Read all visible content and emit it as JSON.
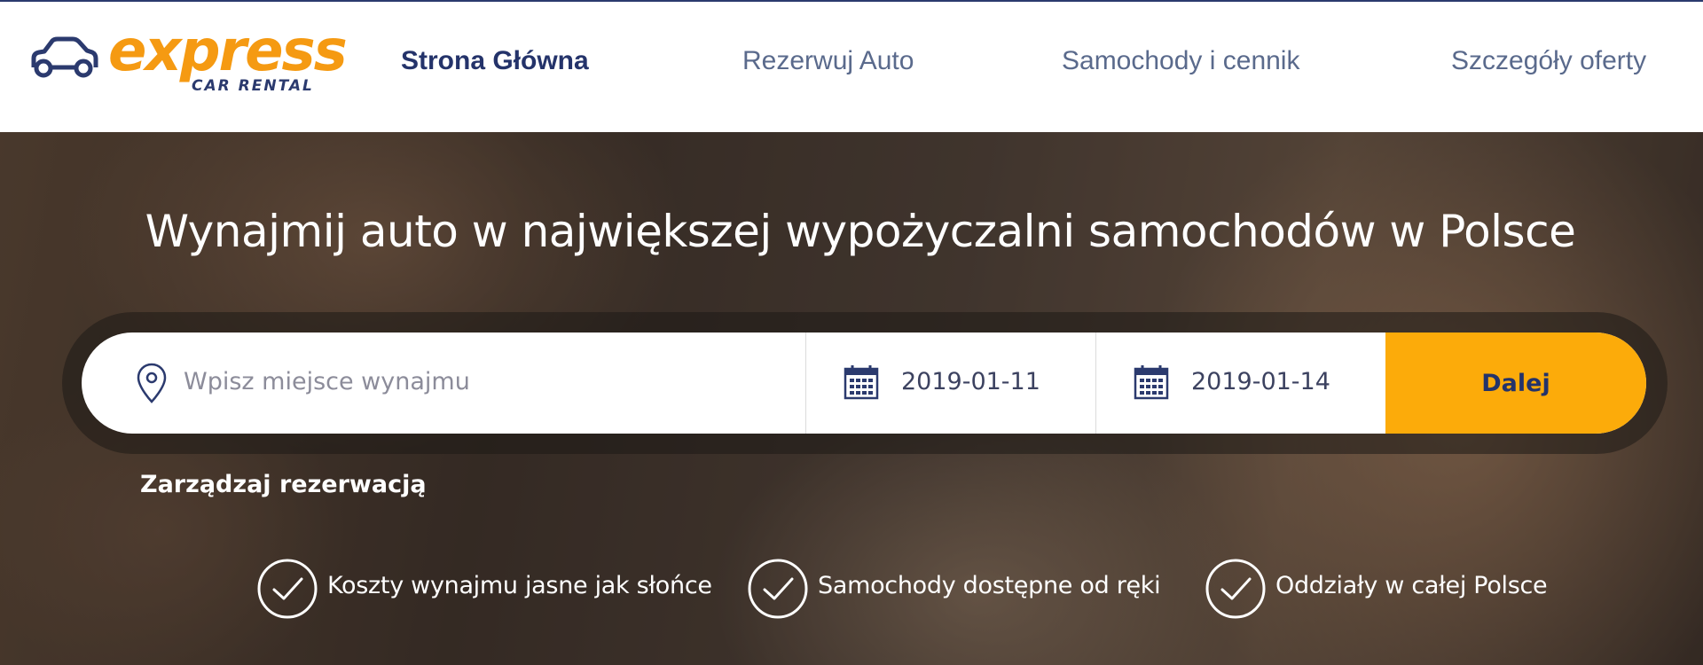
{
  "brand": {
    "word": "express",
    "sub": "CAR RENTAL",
    "colors": {
      "orange": "#f59a12",
      "navy": "#2b3a6e"
    },
    "icon": "car-outline-icon"
  },
  "nav": {
    "items": [
      {
        "label": "Strona Główna",
        "active": true
      },
      {
        "label": "Rezerwuj Auto"
      },
      {
        "label": "Samochody i cennik"
      },
      {
        "label": "Szczegóły oferty"
      }
    ]
  },
  "hero": {
    "title": "Wynajmij auto w największej wypożyczalni samochodów w Polsce"
  },
  "search": {
    "location_placeholder": "Wpisz miejsce wynajmu",
    "location_value": "",
    "pickup_date": "2019-01-11",
    "return_date": "2019-01-14",
    "submit_label": "Dalej",
    "icons": [
      "location-pin-icon",
      "calendar-icon"
    ],
    "button_color": "#fcab0a"
  },
  "manage": {
    "label": "Zarządzaj rezerwacją"
  },
  "features": [
    {
      "text": "Koszty wynajmu jasne jak słońce",
      "icon": "check-circle-icon"
    },
    {
      "text": "Samochody dostępne od ręki",
      "icon": "check-circle-icon"
    },
    {
      "text": "Oddziały w całej Polsce",
      "icon": "check-circle-icon"
    }
  ]
}
